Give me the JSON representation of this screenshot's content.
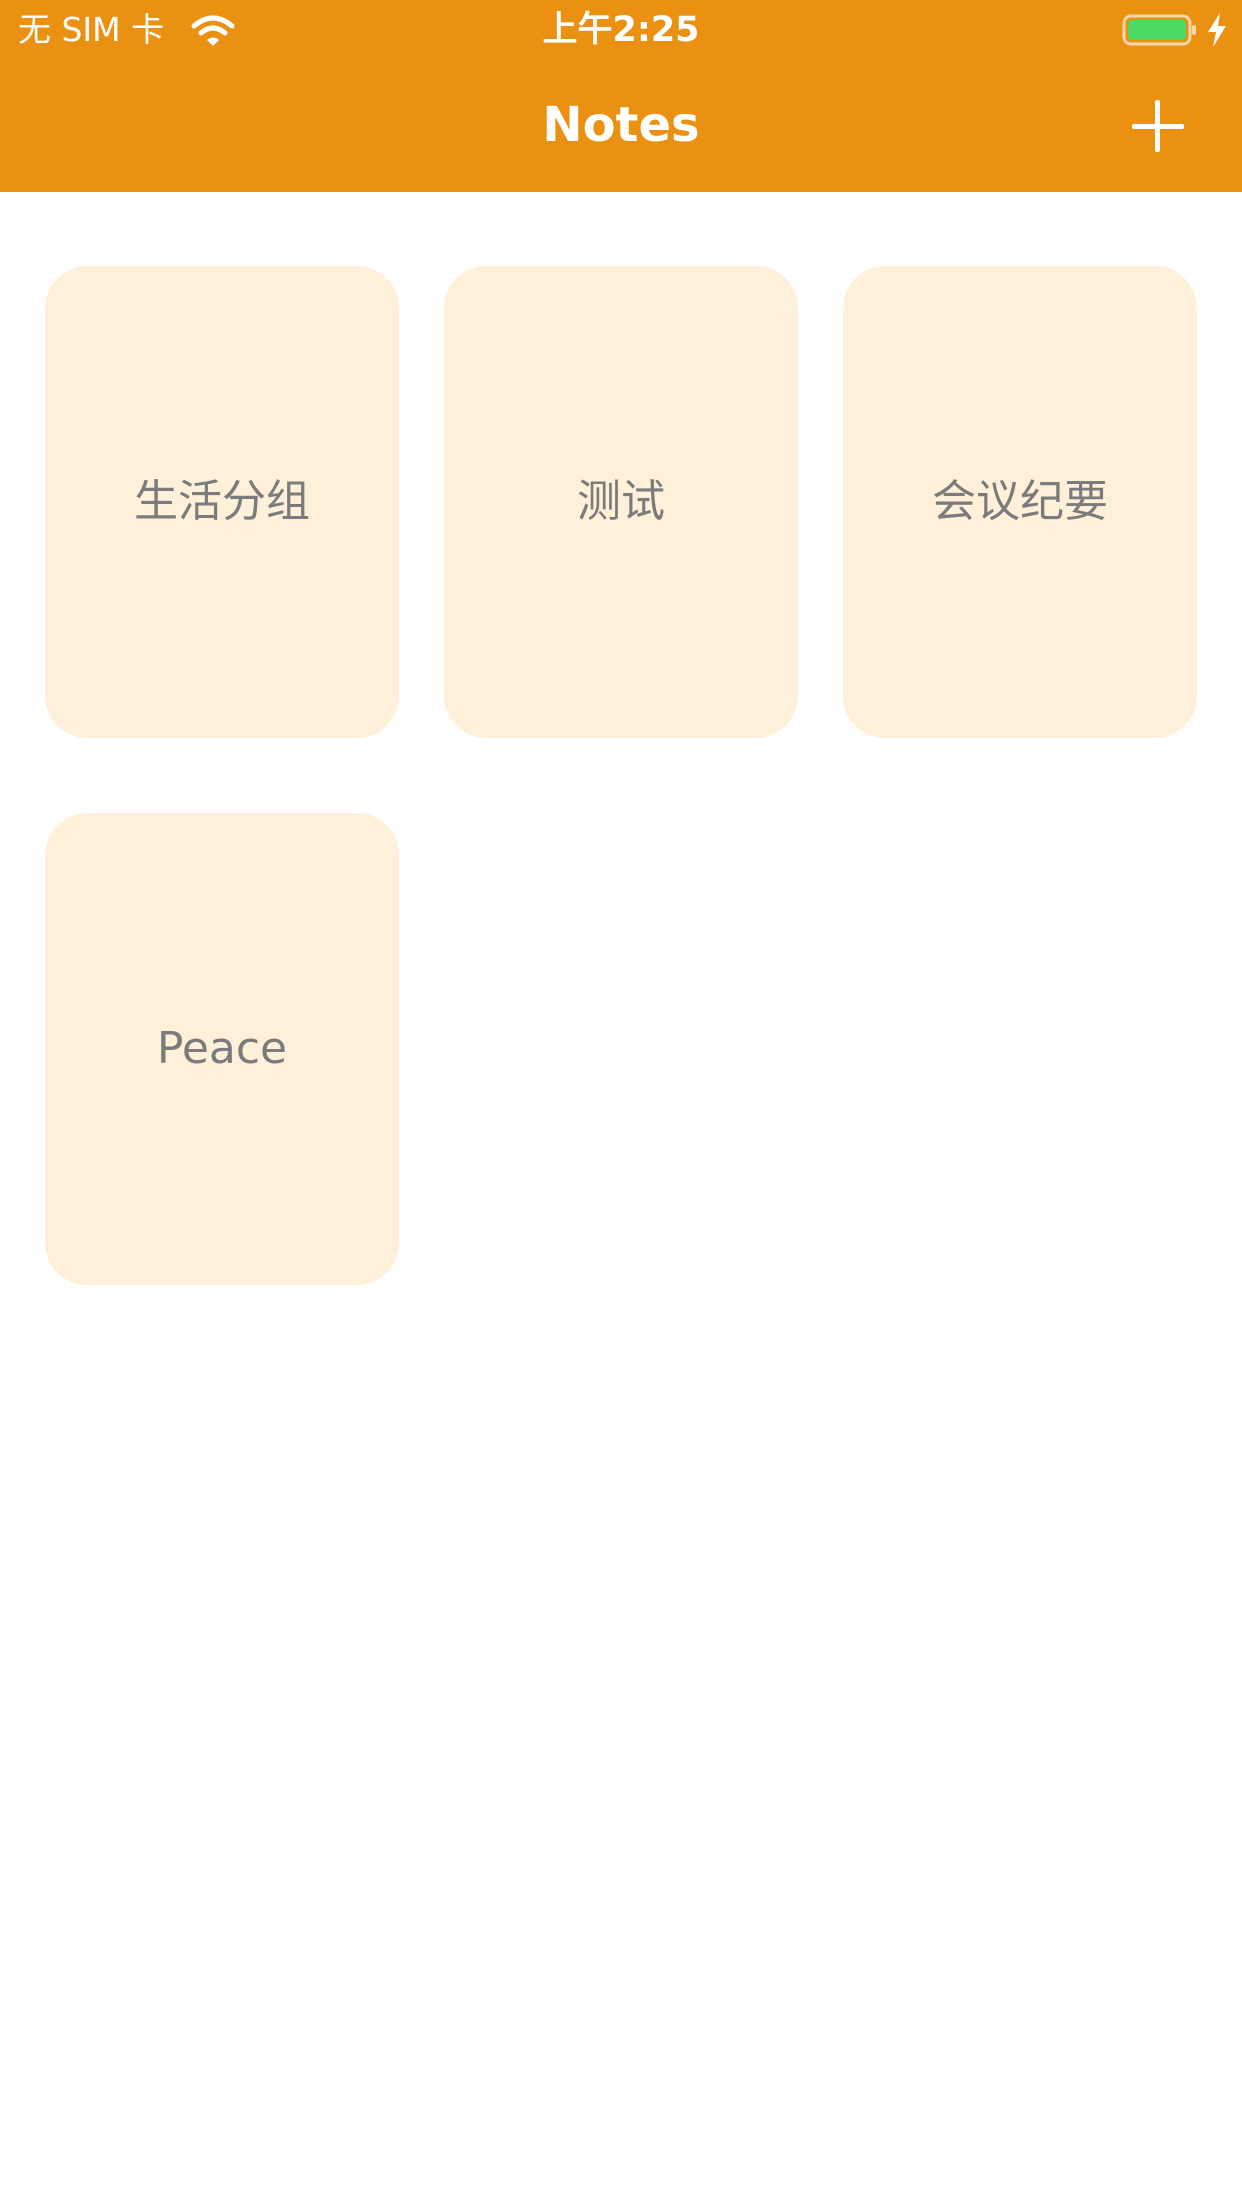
{
  "status_bar": {
    "carrier": "无 SIM 卡",
    "time": "上午2:25",
    "wifi_icon": "wifi-icon",
    "battery_icon": "battery-charging-icon",
    "charging_icon": "lightning-bolt-icon",
    "battery_color": "#4cd964"
  },
  "nav": {
    "title": "Notes",
    "add_icon": "plus-icon",
    "background": "#ea9112"
  },
  "groups": [
    {
      "label": "生活分组"
    },
    {
      "label": "测试"
    },
    {
      "label": "会议纪要"
    },
    {
      "label": "Peace"
    }
  ],
  "colors": {
    "card_background": "#fff0d9",
    "card_text": "#7b7b7b"
  }
}
